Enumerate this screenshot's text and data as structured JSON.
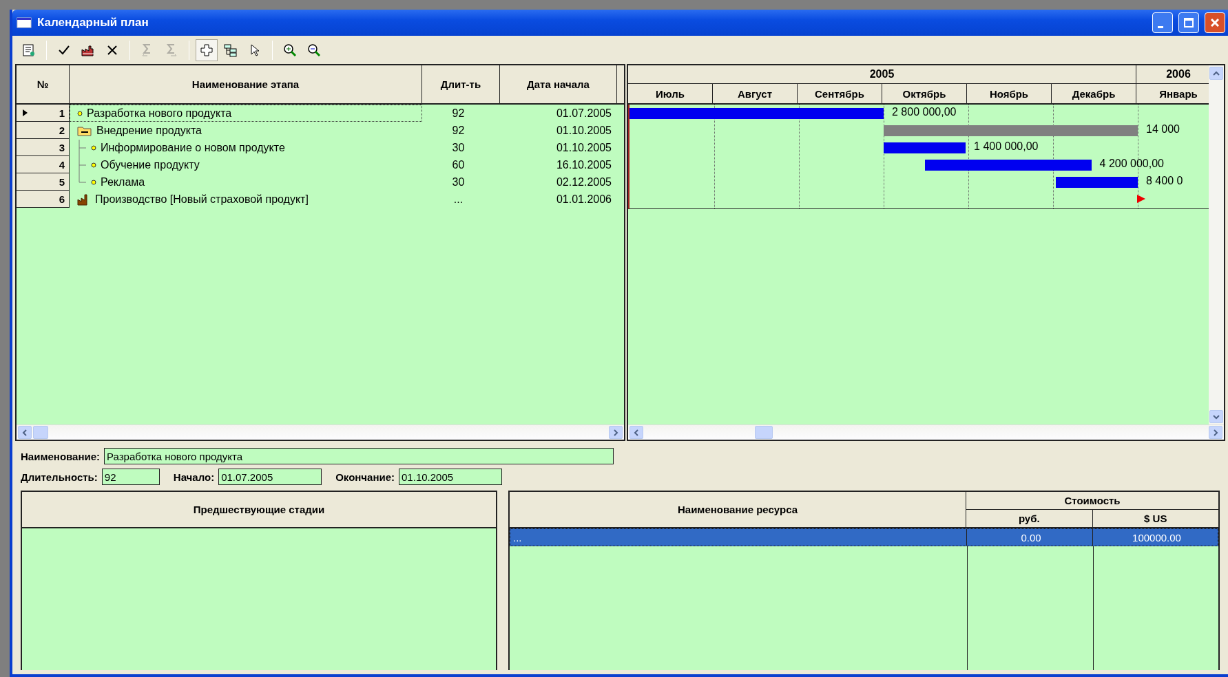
{
  "window": {
    "title": "Календарный план"
  },
  "toolbar": [
    {
      "buttons": [
        {
          "disabled": false,
          "pressed": false
        }
      ]
    },
    {
      "buttons": [
        {
          "disabled": false,
          "pressed": false
        },
        {
          "disabled": false,
          "pressed": false
        },
        {
          "disabled": false,
          "pressed": false
        }
      ]
    },
    {
      "buttons": [
        {
          "disabled": true,
          "pressed": false
        },
        {
          "disabled": true,
          "pressed": false
        }
      ]
    },
    {
      "buttons": [
        {
          "disabled": false,
          "pressed": true
        },
        {
          "disabled": false,
          "pressed": false
        },
        {
          "disabled": false,
          "pressed": false
        }
      ]
    },
    {
      "buttons": [
        {
          "disabled": false,
          "pressed": false
        },
        {
          "disabled": false,
          "pressed": false
        }
      ]
    }
  ],
  "stages_table": {
    "columns": [
      "№",
      "Наименование этапа",
      "Длит-ть",
      "Дата начала"
    ],
    "rows": [
      {
        "no": "1",
        "name": "Разработка нового продукта",
        "duration": "92",
        "start": "01.07.2005",
        "kind": "task",
        "selected": true,
        "bar_label": "2 800 000,00"
      },
      {
        "no": "2",
        "name": "Внедрение продукта",
        "duration": "92",
        "start": "01.10.2005",
        "kind": "summary",
        "selected": false,
        "expanded": true,
        "bar_label": "14 000",
        "children": [
          {
            "no": "3",
            "name": "Информирование о новом продукте",
            "duration": "30",
            "start": "01.10.2005",
            "kind": "task",
            "selected": false,
            "bar_label": "1 400 000,00"
          },
          {
            "no": "4",
            "name": "Обучение продукту",
            "duration": "60",
            "start": "16.10.2005",
            "kind": "task",
            "selected": false,
            "bar_label": "4 200 000,00"
          },
          {
            "no": "5",
            "name": "Реклама",
            "duration": "30",
            "start": "02.12.2005",
            "kind": "task",
            "selected": false,
            "bar_label": "8 400 0"
          }
        ]
      },
      {
        "no": "6",
        "name": "Производство [Новый страховой продукт]",
        "duration": "...",
        "start": "01.01.2006",
        "kind": "milestone",
        "selected": false
      }
    ]
  },
  "timeline": {
    "years": [
      {
        "label": "2005",
        "months": [
          "Июль",
          "Август",
          "Сентябрь",
          "Октябрь",
          "Ноябрь",
          "Декабрь"
        ]
      },
      {
        "label": "2006",
        "months": [
          "Январь"
        ]
      }
    ]
  },
  "details": {
    "name_label": "Наименование:",
    "name_value": "Разработка нового продукта",
    "duration_label": "Длительность:",
    "duration_value": "92",
    "start_label": "Начало:",
    "start_value": "01.07.2005",
    "end_label": "Окончание:",
    "end_value": "01.10.2005"
  },
  "predecessors_table": {
    "columns": [
      "Предшествующие стадии"
    ]
  },
  "resources_table": {
    "name_column": "Наименование ресурса",
    "cost_group": "Стоимость",
    "cost_columns": [
      "руб.",
      "$ US"
    ],
    "rows": [
      {
        "name": "...",
        "rub": "0.00",
        "usd": "100000.00",
        "selected": true
      }
    ]
  }
}
